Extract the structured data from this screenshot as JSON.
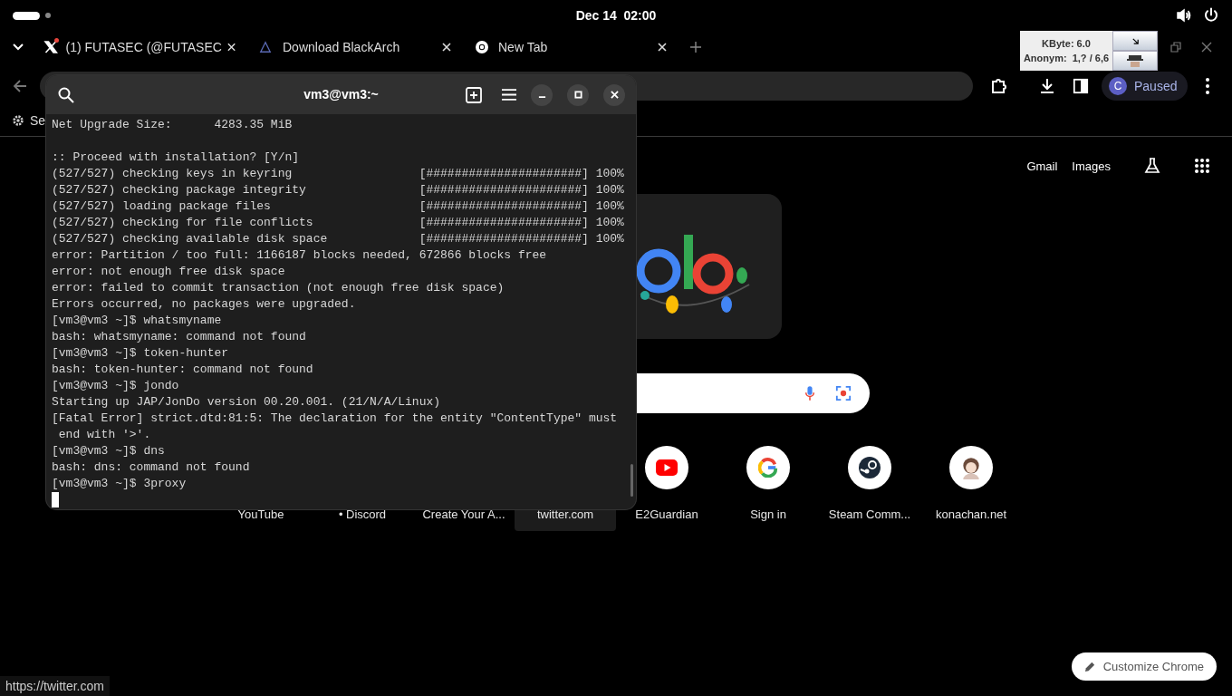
{
  "top_bar": {
    "clock": "Dec 14  02:00"
  },
  "browser": {
    "tabs": [
      {
        "title": "(1) FUTASEC (@FUTASEC",
        "kind": "x",
        "notification": true
      },
      {
        "title": "Download BlackArch",
        "kind": "arch"
      },
      {
        "title": "New Tab",
        "kind": "chrome"
      }
    ],
    "profile": {
      "initial": "C",
      "status": "Paused"
    },
    "bookmark": "Se",
    "ntp_links": [
      "Gmail",
      "Images"
    ],
    "shortcuts": [
      {
        "label": "YouTube",
        "hovered": false
      },
      {
        "label": "• Discord",
        "hovered": false
      },
      {
        "label": "Create Your A...",
        "hovered": false
      },
      {
        "label": "twitter.com",
        "hovered": true
      },
      {
        "label": "E2Guardian",
        "hovered": false,
        "kind": "youtube"
      },
      {
        "label": "Sign in",
        "hovered": false,
        "kind": "google"
      },
      {
        "label": "Steam Comm...",
        "hovered": false,
        "kind": "steam"
      },
      {
        "label": "konachan.net",
        "hovered": false,
        "kind": "avatar"
      }
    ],
    "status_url": "https://twitter.com",
    "customize_button": "Customize Chrome"
  },
  "jondo": {
    "kbyte": "KByte: 6.0",
    "anonym": "Anonym:  1,? / 6,6"
  },
  "terminal": {
    "title": "vm3@vm3:~",
    "blocks": [
      [
        "Net Upgrade Size:      4283.35 MiB"
      ],
      [
        ":: Proceed with installation? [Y/n]",
        "(527/527) checking keys in keyring                  [######################] 100%",
        "(527/527) checking package integrity                [######################] 100%",
        "(527/527) loading package files                     [######################] 100%",
        "(527/527) checking for file conflicts               [######################] 100%",
        "(527/527) checking available disk space             [######################] 100%",
        "error: Partition / too full: 1166187 blocks needed, 672866 blocks free",
        "error: not enough free disk space",
        "error: failed to commit transaction (not enough free disk space)",
        "Errors occurred, no packages were upgraded.",
        "[vm3@vm3 ~]$ whatsmyname",
        "bash: whatsmyname: command not found",
        "[vm3@vm3 ~]$ token-hunter",
        "bash: token-hunter: command not found",
        "[vm3@vm3 ~]$ jondo",
        "Starting up JAP/JonDo version 00.20.001. (21/N/A/Linux)",
        "[Fatal Error] strict.dtd:81:5: The declaration for the entity \"ContentType\" must",
        " end with '>'.",
        "[vm3@vm3 ~]$ dns",
        "bash: dns: command not found",
        "[vm3@vm3 ~]$ 3proxy"
      ]
    ]
  }
}
